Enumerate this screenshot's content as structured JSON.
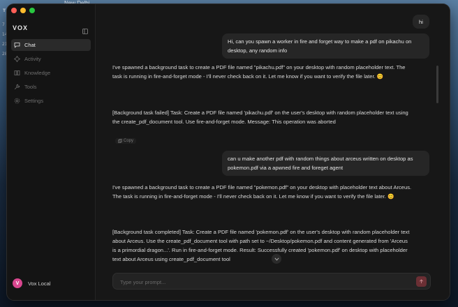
{
  "desktop": {
    "menubar_text": "New Delhi",
    "side_glyphs": [
      "T",
      "7",
      "14",
      "21",
      "28"
    ]
  },
  "app": {
    "brand": "VOX",
    "nav": [
      {
        "label": "Chat",
        "icon": "chat-icon",
        "active": true
      },
      {
        "label": "Activity",
        "icon": "activity-icon",
        "active": false
      },
      {
        "label": "Knowledge",
        "icon": "knowledge-icon",
        "active": false
      },
      {
        "label": "Tools",
        "icon": "wrench-icon",
        "active": false
      },
      {
        "label": "Settings",
        "icon": "gear-icon",
        "active": false
      }
    ],
    "user": {
      "initial": "V",
      "name": "Vox Local"
    }
  },
  "chat": {
    "messages": [
      {
        "role": "user",
        "text": "hi"
      },
      {
        "role": "user",
        "text": "Hi, can you spawn a worker in fire and forget way to make a pdf on pikachu on desktop, any random info"
      },
      {
        "role": "assistant",
        "text": "I've spawned a background task to create a PDF file named \"pikachu.pdf\" on your desktop with random placeholder text. The task is running in fire-and-forget mode - I'll never check back on it. Let me know if you want to verify the file later. 😊"
      },
      {
        "role": "assistant",
        "text": "[Background task failed] Task: Create a PDF file named 'pikachu.pdf' on the user's desktop with random placeholder text using the create_pdf_document tool. Use fire-and-forget mode. Message: This operation was aborted"
      },
      {
        "role": "user",
        "text": "can u make another pdf with random things about arceus written on desktop as pokemon.pdf via a apwned fire and foreget agent"
      },
      {
        "role": "assistant",
        "text": "I've spawned a background task to create a PDF file named \"pokemon.pdf\" on your desktop with placeholder text about Arceus. The task is running in fire-and-forget mode - I'll never check back on it. Let me know if you want to verify the file later. 😊"
      },
      {
        "role": "assistant",
        "text": "[Background task completed] Task: Create a PDF file named 'pokemon.pdf' on the user's desktop with random placeholder text about Arceus. Use the create_pdf_document tool with path set to ~/Desktop/pokemon.pdf and content generated from 'Arceus is a primordial dragon...'. Run in fire-and-forget mode. Result: Successfully created 'pokemon.pdf' on desktop with placeholder text about Arceus using create_pdf_document tool"
      }
    ],
    "copy_label": "Copy",
    "input_placeholder": "Type your prompt..."
  },
  "colors": {
    "accent_avatar": "#d9468f",
    "send_button": "#6b2f34",
    "traffic_red": "#ff5f57",
    "traffic_yellow": "#febc2e",
    "traffic_green": "#28c840"
  }
}
